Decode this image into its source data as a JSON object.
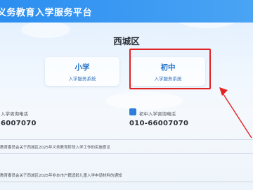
{
  "header": {
    "title": "义务教育入学服务平台"
  },
  "district": "西城区",
  "cards": [
    {
      "title": "小学",
      "subtitle": "入学服务系统"
    },
    {
      "title": "初中",
      "subtitle": "入学服务系统"
    }
  ],
  "phones": {
    "primary": {
      "label": "入学咨询电话",
      "number": "6007070"
    },
    "middle": {
      "label": "初中入学咨询电话",
      "number": "010-66007070"
    }
  },
  "notices": [
    "教育委员会关于西城区2025年义务教育阶段入学工作的实施意见",
    "教育委员会关于西城区2025年非本市户籍适龄儿童入学申请材料的通知"
  ],
  "colors": {
    "header": "#2b8ef0",
    "highlight": "#e22323",
    "accent": "#1f6fc6"
  },
  "icons": {
    "phone": "phone-icon"
  }
}
